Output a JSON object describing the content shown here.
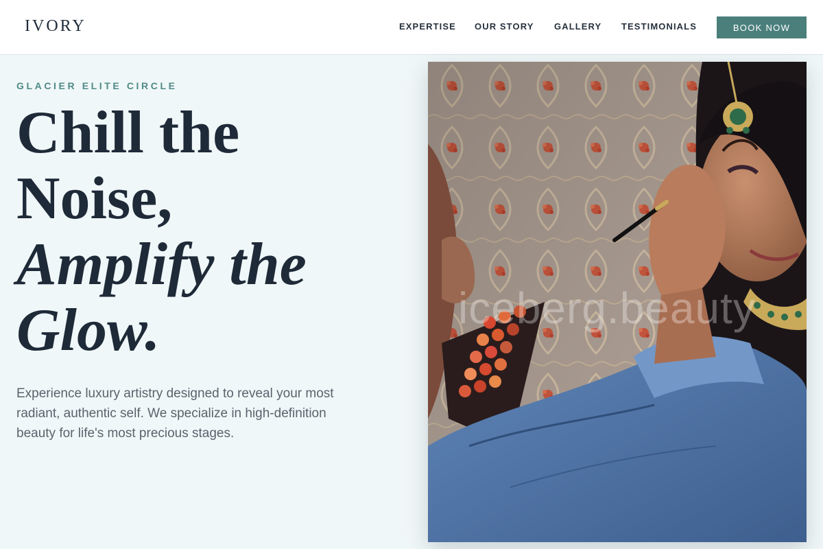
{
  "brand": {
    "logo_text": "IVORY"
  },
  "nav": {
    "links": [
      {
        "label": "EXPERTISE"
      },
      {
        "label": "OUR STORY"
      },
      {
        "label": "GALLERY"
      },
      {
        "label": "TESTIMONIALS"
      }
    ],
    "cta_label": "BOOK NOW"
  },
  "hero": {
    "eyebrow": "GLACIER ELITE CIRCLE",
    "headline_lines": [
      {
        "text": "Chill the",
        "style": "regular"
      },
      {
        "text": "Noise,",
        "style": "regular"
      },
      {
        "text": "Amplify the",
        "style": "italic"
      },
      {
        "text": "Glow.",
        "style": "italic"
      }
    ],
    "lede": "Experience luxury artistry designed to reveal your most radiant, authentic self. We specialize in high-definition beauty for life's most precious stages.",
    "image": {
      "subject": "makeup-artist-applying-bridal-makeup-photo",
      "watermark": "iceberg.beauty"
    }
  },
  "colors": {
    "page_bg": "#f0f7f8",
    "header_bg": "#ffffff",
    "text_dark": "#1e2a38",
    "accent_teal": "#4a7f7c",
    "eyebrow_teal": "#4f8a86",
    "body_gray": "#5a636c"
  }
}
